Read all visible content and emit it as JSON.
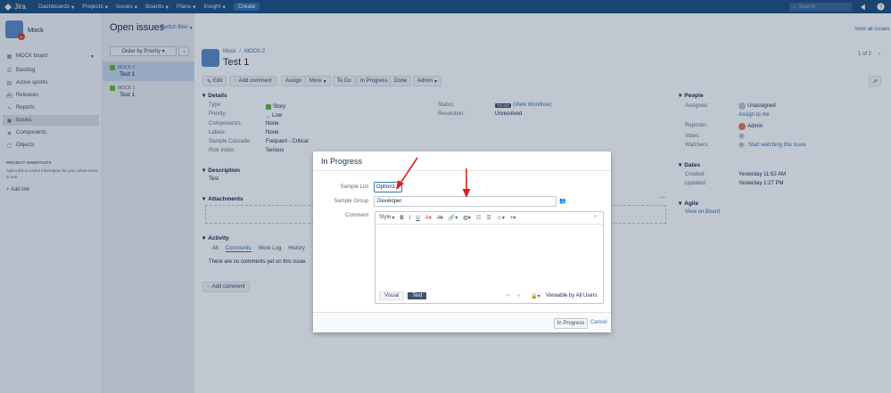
{
  "nav": {
    "logo": "Jira",
    "items": [
      "Dashboards",
      "Projects",
      "Issues",
      "Boards",
      "Plans",
      "Insight"
    ],
    "create": "Create",
    "search_placeholder": "Search"
  },
  "sidebar": {
    "project_name": "Mock",
    "board": "MOCK board",
    "items": [
      {
        "label": "Backlog",
        "icon": "backlog-icon"
      },
      {
        "label": "Active sprints",
        "icon": "sprint-icon"
      },
      {
        "label": "Releases",
        "icon": "ship-icon"
      },
      {
        "label": "Reports",
        "icon": "chart-icon"
      },
      {
        "label": "Issues",
        "icon": "issues-icon"
      },
      {
        "label": "Components",
        "icon": "components-icon"
      },
      {
        "label": "Objects",
        "icon": "objects-icon"
      }
    ],
    "shortcuts_title": "PROJECT SHORTCUTS",
    "shortcuts_text": "Add a link to useful information for your whole team to see.",
    "add_link": "+ Add link"
  },
  "list": {
    "title": "Open issues",
    "switch_filter": "Switch filter",
    "order_by": "Order by Priority",
    "issues": [
      {
        "key": "MOCK-2",
        "summary": "Test 1"
      },
      {
        "key": "MOCK-1",
        "summary": "Test 1"
      }
    ]
  },
  "issue": {
    "breadcrumb_project": "Mock",
    "breadcrumb_key": "MOCK-2",
    "title": "Test 1",
    "pager": "1 of 2",
    "view_all": "View all issues a",
    "toolbar": [
      "Edit",
      "Add comment",
      "Assign",
      "More",
      "To Do",
      "In Progress",
      "Done",
      "Admin"
    ],
    "details_title": "Details",
    "details": [
      {
        "label": "Type:",
        "value": "Story"
      },
      {
        "label": "Priority:",
        "value": "Low"
      },
      {
        "label": "Component/s:",
        "value": "None"
      },
      {
        "label": "Labels:",
        "value": "None"
      },
      {
        "label": "Sample Cascade:",
        "value": "Frequent - Critical"
      },
      {
        "label": "Risk Index:",
        "value": "Serious"
      }
    ],
    "status_label": "Status:",
    "status_value": "TO DO",
    "view_workflow": "(View Workflow)",
    "resolution_label": "Resolution:",
    "resolution_value": "Unresolved",
    "description_title": "Description",
    "description": "Test",
    "attachments_title": "Attachments",
    "activity_title": "Activity",
    "activity_tabs": [
      "All",
      "Comments",
      "Work Log",
      "History"
    ],
    "no_comments": "There are no comments yet on this issue.",
    "add_comment": "Add comment",
    "people_title": "People",
    "assignee_label": "Assignee:",
    "assignee_value": "Unassigned",
    "assign_to_me": "Assign to me",
    "reporter_label": "Reporter:",
    "reporter_value": "Admin",
    "votes_label": "Votes:",
    "votes_value": "0",
    "watchers_label": "Watchers:",
    "watchers_value": "0",
    "start_watching": "Start watching this issue",
    "dates_title": "Dates",
    "created_label": "Created:",
    "created_value": "Yesterday 11:52 AM",
    "updated_label": "Updated:",
    "updated_value": "Yesterday 1:27 PM",
    "agile_title": "Agile",
    "view_on_board": "View on Board"
  },
  "dialog": {
    "title": "In Progress",
    "sample_list_label": "Sample List",
    "sample_list_value": "Option1",
    "sample_group_label": "Sample Group",
    "sample_group_value": "Developer",
    "comment_label": "Comment",
    "style_label": "Style",
    "visual_tab": "Visual",
    "text_tab": "Text",
    "viewable": "Viewable by All Users",
    "submit": "In Progress",
    "cancel": "Cancel"
  },
  "colors": {
    "nav": "#205081",
    "accent": "#3572b0",
    "arrow": "#e02020"
  }
}
